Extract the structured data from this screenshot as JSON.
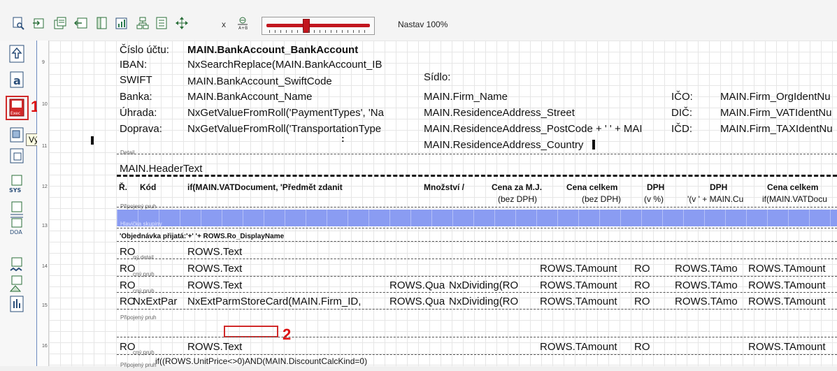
{
  "toolbar": {
    "icons": [
      "print-preview-icon",
      "export-icon",
      "copy-report-icon",
      "import-icon",
      "page-setup-icon",
      "edit-chart-icon",
      "report-tree-icon",
      "properties-icon",
      "move-icon",
      "x-axis-icon",
      "formula-icon"
    ],
    "x_label": "x",
    "zoom_label": "Nastav 100%",
    "zoom_value_percent": 100
  },
  "left_panel": {
    "tooltip": "Výraz",
    "callout_1": "1",
    "callout_2": "2"
  },
  "ruler": [
    "9",
    "10",
    "11",
    "12",
    "13",
    "14",
    "15",
    "16"
  ],
  "report": {
    "header": {
      "cislo_uctu_label": "Číslo účtu:",
      "cislo_uctu_value": "MAIN.BankAccount_BankAccount",
      "iban_label": "IBAN:",
      "iban_value": "NxSearchReplace(MAIN.BankAccount_IB",
      "swift_label": "SWIFT",
      "swift_value": "MAIN.BankAccount_SwiftCode",
      "banka_label": "Banka:",
      "banka_value": "MAIN.BankAccount_Name",
      "uhrada_label": "Úhrada:",
      "uhrada_value": "NxGetValueFromRoll('PaymentTypes', 'Na",
      "doprava_label": "Doprava:",
      "doprava_value": "NxGetValueFromRoll('TransportationType",
      "sidlo_label": "Sídlo:",
      "firm_name": "MAIN.Firm_Name",
      "street": "MAIN.ResidenceAddress_Street",
      "postcode": "MAIN.ResidenceAddress_PostCode + '  ' + MAI",
      "country": "MAIN.ResidenceAddress_Country",
      "ico_label": "IČO:",
      "ico_value": "MAIN.Firm_OrgIdentNu",
      "dic_label": "DIČ:",
      "dic_value": "MAIN.Firm_VATIdentNu",
      "icd_label": "IČD:",
      "icd_value": "MAIN.Firm_TAXIdentNu",
      "detail_band": "Detail",
      "header_text": "MAIN.HeaderText"
    },
    "columns": {
      "r": "Ř.",
      "kod": "Kód",
      "predmet": "if(MAIN.VATDocument, 'Předmět zdanit",
      "mnozstvi": "Množství /",
      "cena_za_mj": "Cena za M.J.",
      "cena_za_mj_sub": "(bez DPH)",
      "cena_celkem": "Cena celkem",
      "cena_celkem_sub": "(bez DPH)",
      "dph_pct": "DPH",
      "dph_pct_sub": "(v %)",
      "dph": "DPH",
      "dph_sub": "'(v ' + MAIN.Cu",
      "cena_celkem2": "Cena celkem",
      "cena_celkem2_sub": "if(MAIN.VATDocu"
    },
    "bands": {
      "pripojeny_pruh": "Připojený pruh",
      "hlavicka_skupiny": "Hlavička skupiny",
      "group_text": "'Objednávka přijatá:'+' '+ ROWS.Ro_DisplayName",
      "dalsi_detail": "ný detail",
      "cny_pruh": "cný pruh",
      "pripojeny_pruh2": "Připojený pruh",
      "last_label": "Připojený pruh"
    },
    "rows": [
      {
        "ro": "RO",
        "text": "ROWS.Text"
      },
      {
        "ro": "RO",
        "text": "ROWS.Text",
        "amount": "ROWS.TAmount",
        "ro2": "RO",
        "amo": "ROWS.TAmo",
        "amount2": "ROWS.TAmount"
      },
      {
        "ro": "RO",
        "text": "ROWS.Text",
        "qua": "ROWS.Qua",
        "div": "NxDividing(RO",
        "amount": "ROWS.TAmount",
        "ro2": "RO",
        "amo": "ROWS.TAmo",
        "amount2": "ROWS.TAmount"
      },
      {
        "ro": "RO",
        "ext1": "NxExtPar",
        "ext2": "NxExtParmStoreCard(MAIN.Firm_ID,",
        "qua": "ROWS.Qua",
        "div": "NxDividing(RO",
        "amount": "ROWS.TAmount",
        "ro2": "RO",
        "amo": "ROWS.TAmo",
        "amount2": "ROWS.TAmount"
      },
      {
        "ro": "RO",
        "text": "ROWS.Text",
        "amount": "ROWS.TAmount",
        "ro2": "RO",
        "amount2": "ROWS.TAmount"
      }
    ],
    "bottom_text": "if((ROWS.UnitPrice<>0)AND(MAIN.DiscountCalcKind=0)"
  }
}
